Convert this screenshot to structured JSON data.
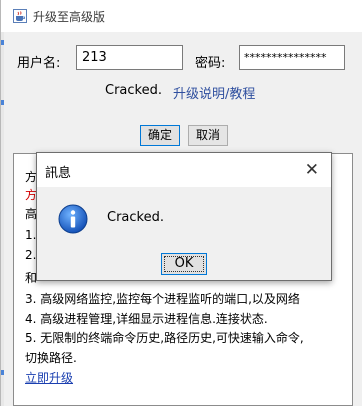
{
  "window": {
    "title": "升级至高级版",
    "icon": "java-cup-icon"
  },
  "form": {
    "username_label": "用户名:",
    "username_value": "213",
    "password_label": "密码:",
    "password_value": "***************",
    "status_text": "Cracked.",
    "help_link": "升级说明/教程",
    "confirm_label": "确定",
    "cancel_label": "取消"
  },
  "info": {
    "line1": "方",
    "line2": "方",
    "line3": "高",
    "line4": "1.",
    "line5": "2.",
    "line6": "和",
    "line7": "3. 高级网络监控,监控每个进程监听的端口,以及网络",
    "line8": "4. 高级进程管理,详细显示进程信息.连接状态.",
    "line9": "5. 无限制的终端命令历史,路径历史,可快速输入命令,",
    "line10": "切换路径.",
    "upgrade_link": "立即升级"
  },
  "dialog": {
    "title": "訊息",
    "message": "Cracked.",
    "ok_label": "OK",
    "icon": "info-icon",
    "close_icon": "close-icon"
  },
  "colors": {
    "link": "#2f4f9f",
    "red_text": "#d40000",
    "focus_border": "#0078d7",
    "info_icon": "#1f6fd1"
  }
}
